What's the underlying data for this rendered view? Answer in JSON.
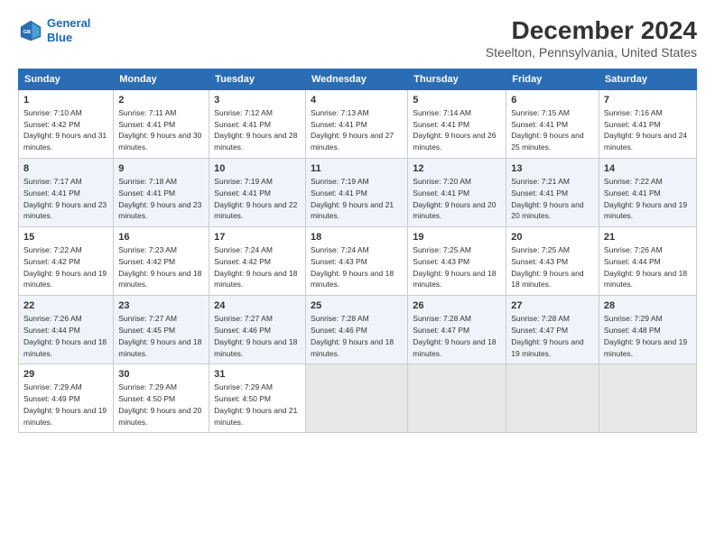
{
  "logo": {
    "line1": "General",
    "line2": "Blue"
  },
  "title": "December 2024",
  "subtitle": "Steelton, Pennsylvania, United States",
  "header_days": [
    "Sunday",
    "Monday",
    "Tuesday",
    "Wednesday",
    "Thursday",
    "Friday",
    "Saturday"
  ],
  "weeks": [
    [
      {
        "day": 1,
        "rise": "7:10 AM",
        "set": "4:42 PM",
        "daylight": "9 hours and 31 minutes."
      },
      {
        "day": 2,
        "rise": "7:11 AM",
        "set": "4:41 PM",
        "daylight": "9 hours and 30 minutes."
      },
      {
        "day": 3,
        "rise": "7:12 AM",
        "set": "4:41 PM",
        "daylight": "9 hours and 28 minutes."
      },
      {
        "day": 4,
        "rise": "7:13 AM",
        "set": "4:41 PM",
        "daylight": "9 hours and 27 minutes."
      },
      {
        "day": 5,
        "rise": "7:14 AM",
        "set": "4:41 PM",
        "daylight": "9 hours and 26 minutes."
      },
      {
        "day": 6,
        "rise": "7:15 AM",
        "set": "4:41 PM",
        "daylight": "9 hours and 25 minutes."
      },
      {
        "day": 7,
        "rise": "7:16 AM",
        "set": "4:41 PM",
        "daylight": "9 hours and 24 minutes."
      }
    ],
    [
      {
        "day": 8,
        "rise": "7:17 AM",
        "set": "4:41 PM",
        "daylight": "9 hours and 23 minutes."
      },
      {
        "day": 9,
        "rise": "7:18 AM",
        "set": "4:41 PM",
        "daylight": "9 hours and 23 minutes."
      },
      {
        "day": 10,
        "rise": "7:19 AM",
        "set": "4:41 PM",
        "daylight": "9 hours and 22 minutes."
      },
      {
        "day": 11,
        "rise": "7:19 AM",
        "set": "4:41 PM",
        "daylight": "9 hours and 21 minutes."
      },
      {
        "day": 12,
        "rise": "7:20 AM",
        "set": "4:41 PM",
        "daylight": "9 hours and 20 minutes."
      },
      {
        "day": 13,
        "rise": "7:21 AM",
        "set": "4:41 PM",
        "daylight": "9 hours and 20 minutes."
      },
      {
        "day": 14,
        "rise": "7:22 AM",
        "set": "4:41 PM",
        "daylight": "9 hours and 19 minutes."
      }
    ],
    [
      {
        "day": 15,
        "rise": "7:22 AM",
        "set": "4:42 PM",
        "daylight": "9 hours and 19 minutes."
      },
      {
        "day": 16,
        "rise": "7:23 AM",
        "set": "4:42 PM",
        "daylight": "9 hours and 18 minutes."
      },
      {
        "day": 17,
        "rise": "7:24 AM",
        "set": "4:42 PM",
        "daylight": "9 hours and 18 minutes."
      },
      {
        "day": 18,
        "rise": "7:24 AM",
        "set": "4:43 PM",
        "daylight": "9 hours and 18 minutes."
      },
      {
        "day": 19,
        "rise": "7:25 AM",
        "set": "4:43 PM",
        "daylight": "9 hours and 18 minutes."
      },
      {
        "day": 20,
        "rise": "7:25 AM",
        "set": "4:43 PM",
        "daylight": "9 hours and 18 minutes."
      },
      {
        "day": 21,
        "rise": "7:26 AM",
        "set": "4:44 PM",
        "daylight": "9 hours and 18 minutes."
      }
    ],
    [
      {
        "day": 22,
        "rise": "7:26 AM",
        "set": "4:44 PM",
        "daylight": "9 hours and 18 minutes."
      },
      {
        "day": 23,
        "rise": "7:27 AM",
        "set": "4:45 PM",
        "daylight": "9 hours and 18 minutes."
      },
      {
        "day": 24,
        "rise": "7:27 AM",
        "set": "4:46 PM",
        "daylight": "9 hours and 18 minutes."
      },
      {
        "day": 25,
        "rise": "7:28 AM",
        "set": "4:46 PM",
        "daylight": "9 hours and 18 minutes."
      },
      {
        "day": 26,
        "rise": "7:28 AM",
        "set": "4:47 PM",
        "daylight": "9 hours and 18 minutes."
      },
      {
        "day": 27,
        "rise": "7:28 AM",
        "set": "4:47 PM",
        "daylight": "9 hours and 19 minutes."
      },
      {
        "day": 28,
        "rise": "7:29 AM",
        "set": "4:48 PM",
        "daylight": "9 hours and 19 minutes."
      }
    ],
    [
      {
        "day": 29,
        "rise": "7:29 AM",
        "set": "4:49 PM",
        "daylight": "9 hours and 19 minutes."
      },
      {
        "day": 30,
        "rise": "7:29 AM",
        "set": "4:50 PM",
        "daylight": "9 hours and 20 minutes."
      },
      {
        "day": 31,
        "rise": "7:29 AM",
        "set": "4:50 PM",
        "daylight": "9 hours and 21 minutes."
      },
      null,
      null,
      null,
      null
    ]
  ]
}
